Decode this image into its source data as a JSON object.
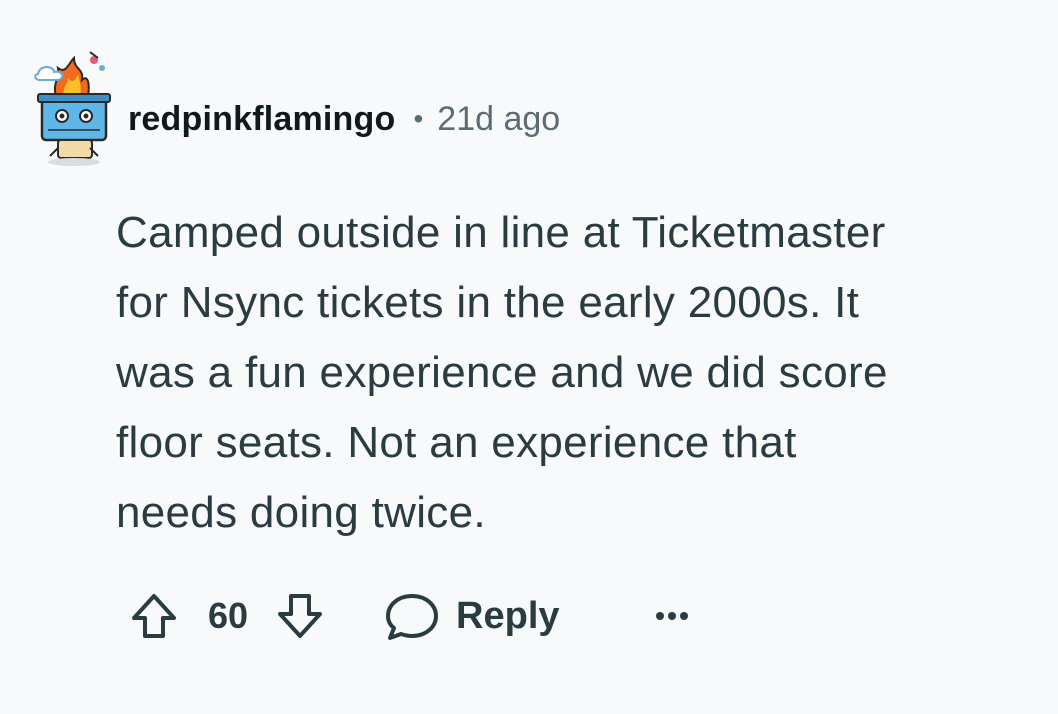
{
  "comment": {
    "author": "redpinkflamingo",
    "separator": "•",
    "timestamp": "21d ago",
    "body_lines": [
      "Camped outside in line at Ticketmaster",
      "for Nsync tickets in the early 2000s. It",
      "was a fun experience and we did score",
      "floor seats. Not an experience that",
      "needs doing twice."
    ]
  },
  "actions": {
    "upvote_icon": "upvote-arrow-icon",
    "score": "60",
    "downvote_icon": "downvote-arrow-icon",
    "reply_icon": "speech-bubble-icon",
    "reply_label": "Reply",
    "more_icon": "ellipsis-icon"
  },
  "colors": {
    "background": "#f7f9fb",
    "text_primary": "#0f1a1c",
    "text_body": "#2a3c42",
    "text_meta": "#5c6c74"
  }
}
